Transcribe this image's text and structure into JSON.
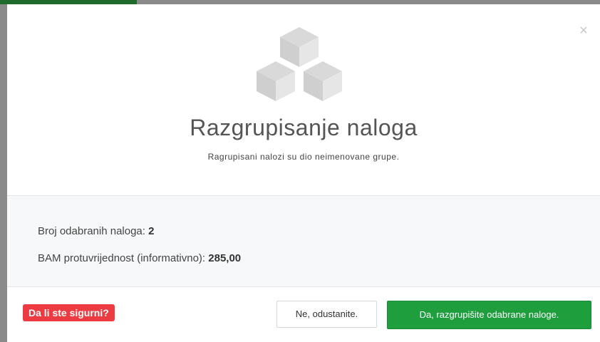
{
  "modal": {
    "title": "Razgrupisanje naloga",
    "subtitle": "Ragrupisani nalozi su dio neimenovane grupe.",
    "close_icon": "close-icon",
    "hero_icon": "cubes-icon"
  },
  "info": {
    "count_label": "Broj odabranih naloga: ",
    "count_value": "2",
    "amount_label": "BAM protuvrijednost (informativno): ",
    "amount_value": "285,00"
  },
  "footer": {
    "confirm_badge": "Da li ste sigurni?",
    "cancel_label": "Ne, odustanite.",
    "confirm_label": "Da, razgrupišite odabrane naloge."
  },
  "colors": {
    "danger": "#ec3b41",
    "success": "#1e9e3d",
    "icon_gray": "#dcdcdc"
  }
}
